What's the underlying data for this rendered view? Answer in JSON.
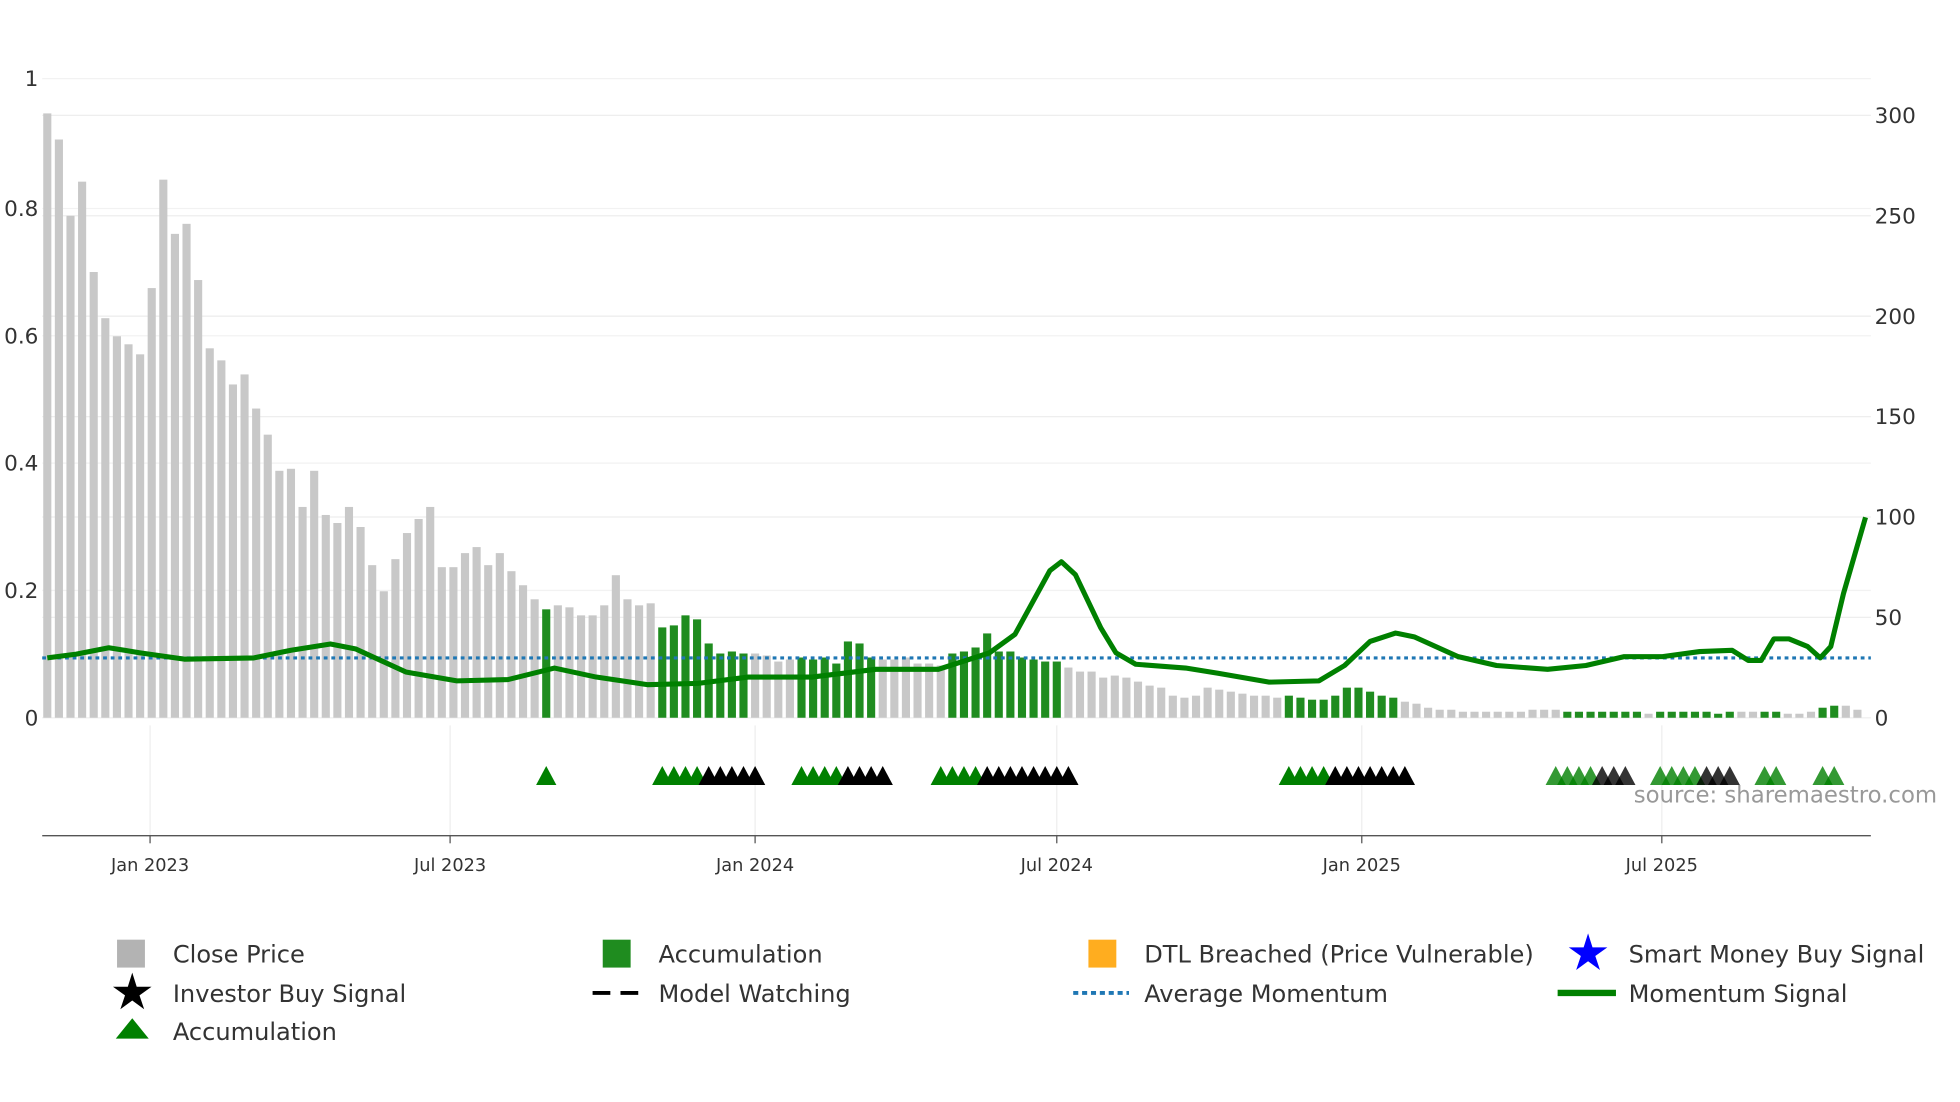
{
  "chart_data": {
    "type": "bar",
    "title": "",
    "start_date": "2022-10-31",
    "freq_days": 7,
    "price_axis": {
      "side": "right",
      "ticks": [
        0,
        50,
        100,
        150,
        200,
        250,
        300
      ],
      "range": [
        0,
        300
      ]
    },
    "momentum_axis": {
      "side": "left",
      "ticks": [
        "0",
        "0.2",
        "0.4",
        "0.6",
        "0.8",
        "1"
      ],
      "range": [
        0,
        1
      ]
    },
    "x_ticks": [
      {
        "label": "Jan 2023",
        "date": "2023-01-01"
      },
      {
        "label": "Jul 2023",
        "date": "2023-07-01"
      },
      {
        "label": "Jan 2024",
        "date": "2024-01-01"
      },
      {
        "label": "Jul 2024",
        "date": "2024-07-01"
      },
      {
        "label": "Jan 2025",
        "date": "2025-01-01"
      },
      {
        "label": "Jul 2025",
        "date": "2025-07-01"
      }
    ],
    "close_price": [
      301,
      288,
      250,
      267,
      222,
      199,
      190,
      186,
      181,
      214,
      268,
      241,
      246,
      218,
      184,
      178,
      166,
      171,
      154,
      141,
      123,
      124,
      105,
      123,
      101,
      97,
      105,
      95,
      76,
      63,
      79,
      92,
      99,
      105,
      75,
      75,
      82,
      85,
      76,
      82,
      73,
      66,
      59,
      54,
      56,
      55,
      51,
      51,
      56,
      71,
      59,
      56,
      57,
      45,
      46,
      51,
      49,
      37,
      32,
      33,
      32,
      32,
      31,
      28,
      29,
      30,
      29,
      30,
      27,
      38,
      37,
      30,
      29,
      29,
      30,
      27,
      27,
      26,
      32,
      33,
      35,
      42,
      33,
      33,
      30,
      29,
      28,
      28,
      25,
      23,
      23,
      20,
      21,
      20,
      18,
      16,
      15,
      11,
      10,
      11,
      15,
      14,
      13,
      12,
      11,
      11,
      10,
      11,
      10,
      9,
      9,
      11,
      15,
      15,
      13,
      11,
      10,
      8,
      7,
      5,
      4,
      4,
      3,
      3,
      3,
      3,
      3,
      3,
      4,
      4,
      4,
      3,
      3,
      3,
      3,
      3,
      3,
      3,
      2,
      3,
      3,
      3,
      3,
      3,
      2,
      3,
      3,
      3,
      3,
      3,
      2,
      2,
      3,
      5,
      6,
      6,
      4
    ],
    "accumulation_weeks": [
      43,
      53,
      54,
      55,
      56,
      57,
      58,
      59,
      60,
      65,
      66,
      67,
      68,
      69,
      70,
      71,
      78,
      79,
      80,
      81,
      82,
      83,
      84,
      85,
      86,
      87,
      107,
      108,
      109,
      110,
      111,
      112,
      113,
      114,
      115,
      116,
      131,
      132,
      133,
      134,
      135,
      136,
      137,
      139,
      140,
      141,
      142,
      143,
      144,
      145,
      148,
      149,
      153,
      154
    ],
    "momentum_signal": [
      [
        0,
        0.094
      ],
      [
        2.5,
        0.1
      ],
      [
        5.3,
        0.11
      ],
      [
        8,
        0.102
      ],
      [
        11.8,
        0.092
      ],
      [
        17.8,
        0.094
      ],
      [
        21,
        0.106
      ],
      [
        24.4,
        0.116
      ],
      [
        26.6,
        0.108
      ],
      [
        30.9,
        0.072
      ],
      [
        35.3,
        0.058
      ],
      [
        39.7,
        0.06
      ],
      [
        43.7,
        0.078
      ],
      [
        47.3,
        0.064
      ],
      [
        51.7,
        0.052
      ],
      [
        56.1,
        0.054
      ],
      [
        60.4,
        0.064
      ],
      [
        65.9,
        0.064
      ],
      [
        71.4,
        0.076
      ],
      [
        76.8,
        0.076
      ],
      [
        81.2,
        0.102
      ],
      [
        83.4,
        0.131
      ],
      [
        86.4,
        0.231
      ],
      [
        87.4,
        0.245
      ],
      [
        88.6,
        0.225
      ],
      [
        90.8,
        0.141
      ],
      [
        92.1,
        0.102
      ],
      [
        93.8,
        0.084
      ],
      [
        98.1,
        0.078
      ],
      [
        100.9,
        0.07
      ],
      [
        105.3,
        0.056
      ],
      [
        109.6,
        0.058
      ],
      [
        111.8,
        0.082
      ],
      [
        114,
        0.12
      ],
      [
        116.2,
        0.133
      ],
      [
        117.8,
        0.127
      ],
      [
        121.6,
        0.096
      ],
      [
        124.9,
        0.082
      ],
      [
        129.3,
        0.076
      ],
      [
        132.6,
        0.082
      ],
      [
        135.9,
        0.096
      ],
      [
        139.2,
        0.096
      ],
      [
        142.4,
        0.104
      ],
      [
        145.2,
        0.106
      ],
      [
        146.6,
        0.09
      ],
      [
        147.7,
        0.09
      ],
      [
        148.8,
        0.124
      ],
      [
        150.1,
        0.124
      ],
      [
        151.7,
        0.112
      ],
      [
        152.8,
        0.094
      ],
      [
        153.7,
        0.112
      ],
      [
        154.8,
        0.195
      ],
      [
        156.7,
        0.315
      ]
    ],
    "average_momentum": 0.094,
    "signal_markers": {
      "accumulation": [
        43,
        53,
        54,
        55,
        56,
        65,
        66,
        67,
        68,
        77,
        78,
        79,
        80,
        107,
        108,
        109,
        110,
        130,
        131,
        132,
        133,
        139,
        140,
        141,
        142,
        148,
        149,
        153,
        154
      ],
      "investor_buy": [
        57,
        58,
        59,
        60,
        61,
        69,
        70,
        71,
        72,
        81,
        82,
        83,
        84,
        85,
        86,
        87,
        88,
        111,
        112,
        113,
        114,
        115,
        116,
        117,
        134,
        135,
        136,
        143,
        144,
        145
      ]
    },
    "legend": [
      {
        "label": "Close Price",
        "color": "#b3b3b3",
        "shape": "square"
      },
      {
        "label": "Accumulation",
        "color": "#1f8c1f",
        "shape": "square"
      },
      {
        "label": "DTL Breached (Price Vulnerable)",
        "color": "#ffad1f",
        "shape": "square"
      },
      {
        "label": "Smart Money Buy Signal",
        "color": "#0000ff",
        "shape": "star"
      },
      {
        "label": "Investor Buy Signal",
        "color": "#000000",
        "shape": "star"
      },
      {
        "label": "Model Watching",
        "color": "#000000",
        "shape": "dash"
      },
      {
        "label": "Average Momentum",
        "color": "#1f77b4",
        "shape": "dot"
      },
      {
        "label": "Momentum Signal",
        "color": "#008000",
        "shape": "line"
      },
      {
        "label": "Accumulation",
        "color": "#008000",
        "shape": "triangle"
      }
    ],
    "source": "source: sharemaestro.com"
  }
}
